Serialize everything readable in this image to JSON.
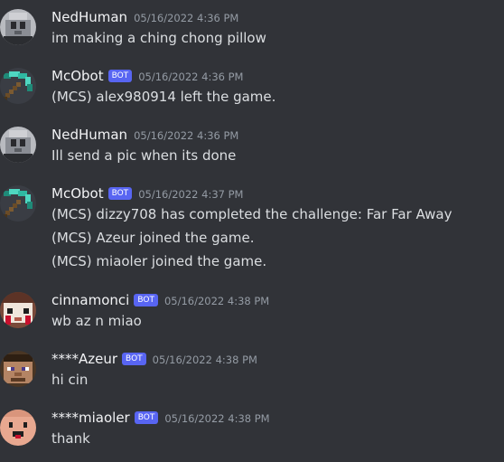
{
  "colors": {
    "background": "#313338",
    "username": "#f2f3f5",
    "bot_tag": "#5865f2",
    "timestamp": "#949ba4",
    "text": "#dbdee1"
  },
  "messages": [
    {
      "author": "NedHuman",
      "bot": false,
      "timestamp": "05/16/2022 4:36 PM",
      "avatar": "nedhuman-avatar",
      "lines": [
        "im making a ching chong pillow"
      ]
    },
    {
      "author": "McObot",
      "bot": true,
      "bot_label": "BOT",
      "timestamp": "05/16/2022 4:36 PM",
      "avatar": "pickaxe-avatar",
      "lines": [
        "(MCS) alex980914 left the game."
      ]
    },
    {
      "author": "NedHuman",
      "bot": false,
      "timestamp": "05/16/2022 4:36 PM",
      "avatar": "nedhuman-avatar",
      "lines": [
        "Ill send a pic when its done"
      ]
    },
    {
      "author": "McObot",
      "bot": true,
      "bot_label": "BOT",
      "timestamp": "05/16/2022 4:37 PM",
      "avatar": "pickaxe-avatar",
      "lines": [
        "(MCS) dizzy708 has completed the challenge: Far Far Away",
        "(MCS) Azeur joined the game.",
        "(MCS) miaoler joined the game."
      ]
    },
    {
      "author": "cinnamonci",
      "bot": true,
      "bot_label": "BOT",
      "timestamp": "05/16/2022 4:38 PM",
      "avatar": "cinnamon-avatar",
      "lines": [
        "wb az n miao"
      ]
    },
    {
      "author": "****Azeur",
      "bot": true,
      "bot_label": "BOT",
      "timestamp": "05/16/2022 4:38 PM",
      "avatar": "azeur-avatar",
      "lines": [
        "hi cin"
      ]
    },
    {
      "author": "****miaoler",
      "bot": true,
      "bot_label": "BOT",
      "timestamp": "05/16/2022 4:38 PM",
      "avatar": "miaoler-avatar",
      "lines": [
        "thank"
      ]
    }
  ]
}
